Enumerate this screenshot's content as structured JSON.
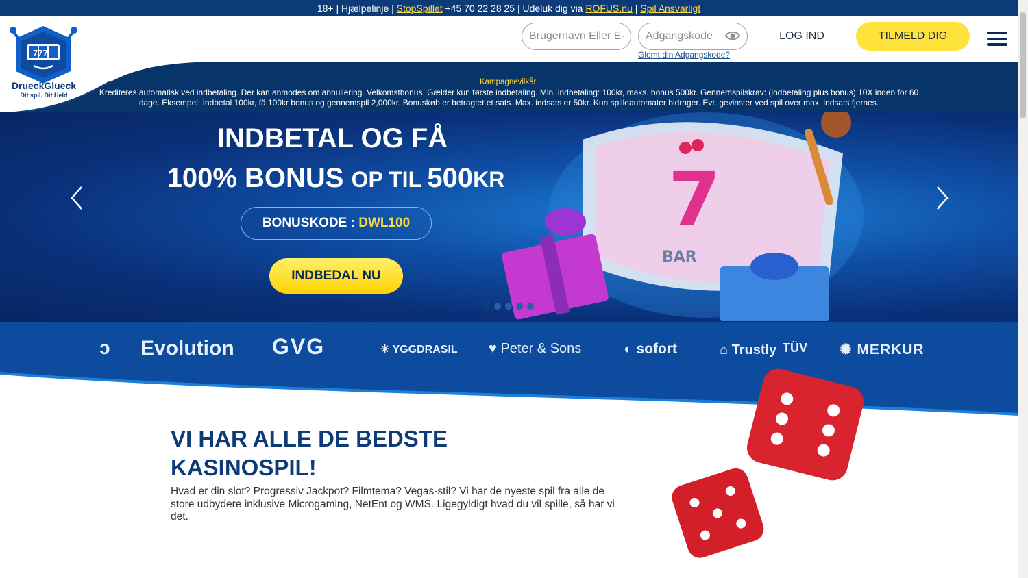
{
  "topbar": {
    "age": "18+",
    "helpline_label": "Hjælpelinje",
    "stopspillet": "StopSpillet",
    "phone": "+45 70 22 28 25",
    "exclude_label": "Udeluk dig via",
    "rofus": "ROFUS.nu",
    "responsible": "Spil Ansvarligt"
  },
  "logo": {
    "brand": "DrueckGlueck",
    "tagline": "Dit spil. Dit Held",
    "reels": "777"
  },
  "header": {
    "username_placeholder": "Brugernavn Eller E-",
    "password_placeholder": "Adgangskode",
    "forgot": "Glemt din Adgangskode?",
    "login": "LOG IND",
    "signup": "TILMELD DIG"
  },
  "terms": {
    "title": "Kampagnevilkår.",
    "text": "Krediteres automatisk ved indbetaling. Der kan anmodes om annullering. Velkomstbonus. Gælder kun første indbetaling. Min. indbetaling: 100kr, maks. bonus 500kr. Gennemspilskrav: (indbetaling plus bonus) 10X inden for 60 dage. Eksempel: Indbetal 100kr, få 100kr bonus og gennemspil 2,000kr. Bonuskøb er betragtet et sats. Max. indsats er 50kr. Kun spilleautomater bidrager. Evt. gevinster ved spil over max. indsats fjernes."
  },
  "hero": {
    "line1": "INDBETAL OG FÅ",
    "line2_a": "100% BONUS ",
    "line2_b": "OP TIL ",
    "line2_c": "500",
    "line2_d": "KR",
    "bonus_label": "BONUSKODE : ",
    "bonus_code": "DWL100",
    "cta": "INDBEDAL NU",
    "slot_symbol": "7",
    "slot_bar": "BAR",
    "slides": 5,
    "active_slide": 1
  },
  "providers": [
    "Evolution",
    "GVG",
    "YGGDRASIL",
    "Peter & Sons",
    "sofort",
    "Trustly",
    "TÜV",
    "MERKUR"
  ],
  "content": {
    "title_line1": "VI HAR ALLE DE BEDSTE",
    "title_line2": "KASINOSPIL!",
    "text": "Hvad er din slot? Progressiv Jackpot? Filmtema? Vegas-stil? Vi har de nyeste spil fra alle de store udbydere inklusive Microgaming, NetEnt og WMS. Ligegyldigt hvad du vil spille, så har vi det."
  },
  "colors": {
    "brand_blue": "#0d3b78",
    "accent_yellow": "#ffe33c",
    "hero_blue": "#0f4fa6"
  }
}
